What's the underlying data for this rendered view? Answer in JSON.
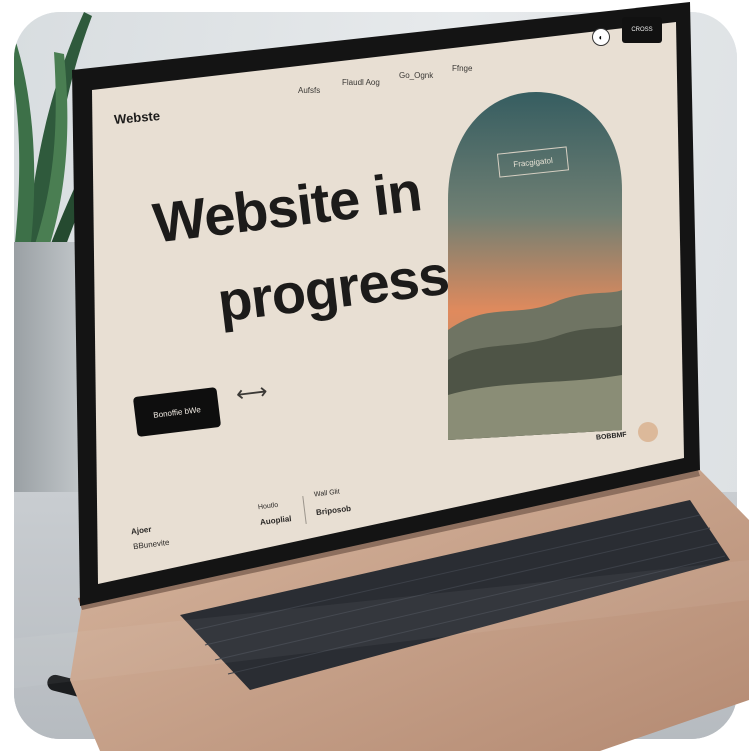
{
  "site": {
    "logo": "Webste",
    "nav": [
      "Aufsfs",
      "Flaudl Aog",
      "Go_Ognk",
      "Ffnge"
    ],
    "hero_line1": "Website in",
    "hero_line2": "progress",
    "cta_label": "Bonoffie bWe",
    "arch_label": "Fracgigatol",
    "signature": "BOBBMF",
    "top_button": "CROSS",
    "footer": {
      "col1_line1": "Ajoer",
      "col1_line2": "BBunevite",
      "col2_line1": "Houtlo",
      "col2_line2": "Auoplial",
      "col3_line1": "Wall Glit",
      "col3_line2": "Briposob"
    }
  },
  "colors": {
    "screen_bg": "#e8dfd3",
    "cta_bg": "#0e0e0e",
    "arch_top": "#3d6466",
    "arch_mid": "#e1875b",
    "laptop_body": "#c9a28a",
    "keyboard": "#2a2d33"
  }
}
